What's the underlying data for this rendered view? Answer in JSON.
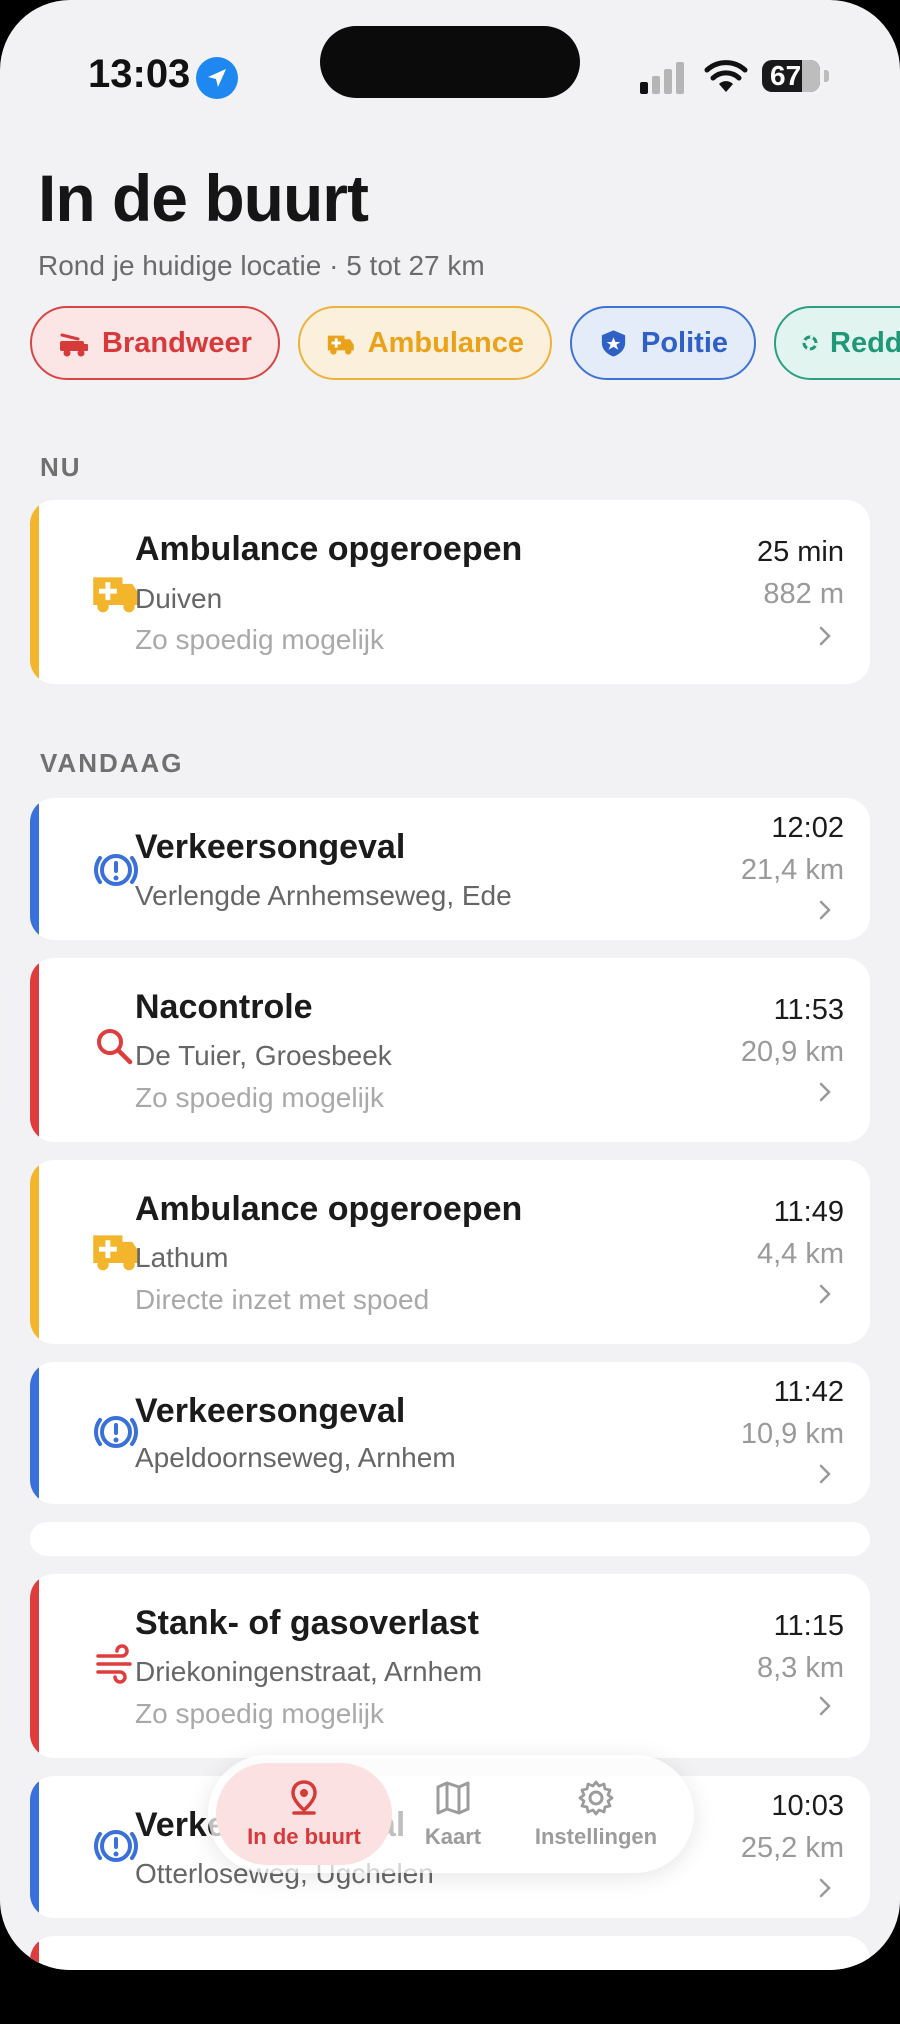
{
  "status": {
    "time": "13:03",
    "battery": "67"
  },
  "header": {
    "title": "In de buurt",
    "subtitle": "Rond je huidige locatie · 5 tot 27 km"
  },
  "filters": [
    {
      "label": "Brandweer",
      "icon": "fire-truck-icon",
      "color": "#d63a3a"
    },
    {
      "label": "Ambulance",
      "icon": "ambulance-icon",
      "color": "#eaa21b"
    },
    {
      "label": "Politie",
      "icon": "police-badge-icon",
      "color": "#2e60c6"
    },
    {
      "label": "Redding",
      "icon": "lifebuoy-icon",
      "color": "#1f9878"
    }
  ],
  "sections": {
    "now": "NU",
    "today": "VANDAAG"
  },
  "now_items": [
    {
      "title": "Ambulance opgeroepen",
      "location": "Duiven",
      "priority": "Zo spoedig mogelijk",
      "time": "25 min",
      "distance": "882 m",
      "service": "ambulance",
      "icon": "ambulance-icon"
    }
  ],
  "today_items": [
    {
      "title": "Verkeersongeval",
      "location": "Verlengde Arnhemseweg, Ede",
      "priority": "",
      "time": "12:02",
      "distance": "21,4 km",
      "service": "politie",
      "icon": "alert-icon"
    },
    {
      "title": "Nacontrole",
      "location": "De Tuier, Groesbeek",
      "priority": "Zo spoedig mogelijk",
      "time": "11:53",
      "distance": "20,9 km",
      "service": "brandweer",
      "icon": "search-icon"
    },
    {
      "title": "Ambulance opgeroepen",
      "location": "Lathum",
      "priority": "Directe inzet met spoed",
      "time": "11:49",
      "distance": "4,4 km",
      "service": "ambulance",
      "icon": "ambulance-icon"
    },
    {
      "title": "Verkeersongeval",
      "location": "Apeldoornseweg, Arnhem",
      "priority": "",
      "time": "11:42",
      "distance": "10,9 km",
      "service": "politie",
      "icon": "alert-icon"
    },
    {
      "title": "Stank- of gasoverlast",
      "location": "Driekoningenstraat, Arnhem",
      "priority": "Zo spoedig mogelijk",
      "time": "11:15",
      "distance": "8,3 km",
      "service": "brandweer",
      "icon": "wind-icon"
    },
    {
      "title": "Verkeersongeval",
      "location": "Otterloseweg, Ugchelen",
      "priority": "",
      "time": "10:03",
      "distance": "25,2 km",
      "service": "politie",
      "icon": "alert-icon"
    }
  ],
  "tabbar": {
    "tabs": [
      {
        "label": "In de buurt",
        "icon": "location-pin-icon",
        "active": true
      },
      {
        "label": "Kaart",
        "icon": "map-icon",
        "active": false
      },
      {
        "label": "Instellingen",
        "icon": "gear-icon",
        "active": false
      }
    ]
  }
}
